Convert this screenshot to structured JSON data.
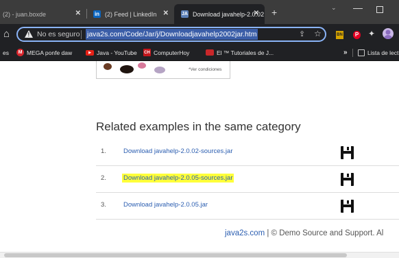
{
  "browser": {
    "tabs": [
      {
        "title": "(2) - juan.boxde",
        "active": false
      },
      {
        "title": "(2) Feed | LinkedIn",
        "active": false,
        "favicon": "in"
      },
      {
        "title": "Download javahelp-2.0.02",
        "active": true,
        "favicon": "JA"
      }
    ],
    "new_tab_label": "+",
    "tab_search_label": "⌄",
    "minimize_label": "—",
    "omnibox": {
      "security_label": "No es seguro",
      "url": "java2s.com/Code/Jar/j/Downloadjavahelp2002jar.htm"
    },
    "extensions": {
      "ext1_label": "BN",
      "pinterest_label": "P",
      "puzzle_label": "✦"
    },
    "bookmarks": {
      "es_label": "es",
      "mega_label": "MEGA ponfe daw",
      "mega_icon": "M",
      "youtube_label": "Java - YouTube",
      "youtube_icon": "▶",
      "computerhoy_label": "ComputerHoy",
      "computerhoy_icon": "CH",
      "el_label": "El ™ Tutoriales de J...",
      "more_label": "»",
      "reading_list_label": "Lista de lectura"
    },
    "colors": {
      "accent": "#8ab4f8",
      "url_highlight": "#3b5ea8",
      "chrome_dark": "#202124"
    }
  },
  "page": {
    "ad_text": "*Ver condiciones",
    "related_title": "Related examples in the same category",
    "related_items": [
      {
        "num": "1.",
        "label": "Download javahelp-2.0.02-sources.jar",
        "highlighted": false
      },
      {
        "num": "2.",
        "label": "Download javahelp-2.0.05-sources.jar",
        "highlighted": true
      },
      {
        "num": "3.",
        "label": "Download javahelp-2.0.05.jar",
        "highlighted": false
      }
    ],
    "footer": {
      "site_link": "java2s.com",
      "text": " | © Demo Source and Support. Al"
    },
    "colors": {
      "link": "#2a5db0",
      "highlight": "#ffff3a"
    }
  }
}
